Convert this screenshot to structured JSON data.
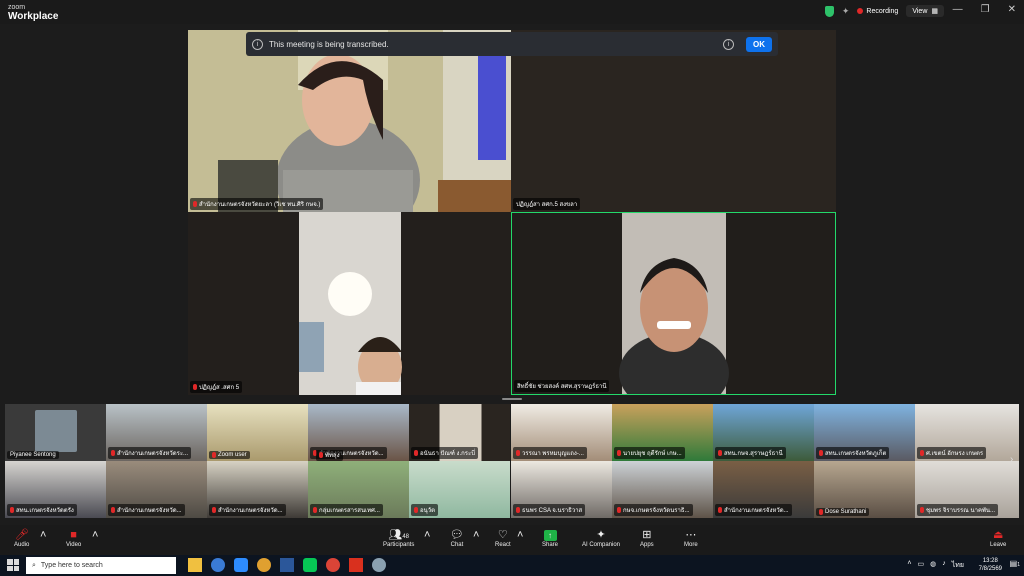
{
  "window": {
    "brand_small": "zoom",
    "brand": "Workplace",
    "recording": "Recording",
    "view": "View"
  },
  "banner": {
    "text": "This meeting is being transcribed.",
    "ok": "OK"
  },
  "main": [
    "สำนักงานเกษตรจังหวัดยะลา (วิเช ทน.ศิริ กษจ.)",
    "ปฏิญฎ์สา สศก.5 สงขลา",
    "ปฏิญฎ์ส .สศก 5",
    "สิทธิ์ชัย ช่วยสงค์ สศท.สุราษฎร์ธานี"
  ],
  "strip_top": [
    "Piyanee Sentong",
    "สำนักงานเกษตรจังหวัดระ...",
    "Zoom user",
    "สำนักงานเกษตรจังหวัด...",
    "พัทลุง",
    "อนันธา ปัณฑ์ ง.กระบี่",
    "วรรณา พรหมบุญแถง-...",
    "นายปยุช ฤดีรักษ์ เกษ...",
    "สทน.กษจ.สุราษฎร์ธานี",
    "สทน.เกษตรจังหวัดภูเก็ต",
    "ศ.เขตน์ อักษรง เกษตร"
  ],
  "strip_bottom": [
    "สทน.เกษตรจังหวัดตรัง",
    "สำนักงานเกษตรจังหวัด...",
    "สำนักงานเกษตรจังหวัด...",
    "กลุ่มเกษตรสารสนเทศ...",
    "อนุวัต",
    "ธนพร CSA จ.นราธิวาส",
    "กษจ.เกษตรจังหวัดนราธิ...",
    "สำนักงานเกษตรจังหวัด...",
    "Dose Surathani",
    "ชุมพร จิราบรรณ นาคพัน..."
  ],
  "toolbar": {
    "audio": "Audio",
    "video": "Video",
    "participants": "Participants",
    "participants_count": "48",
    "chat": "Chat",
    "react": "React",
    "share": "Share",
    "ai": "AI Companion",
    "apps": "Apps",
    "more": "More",
    "leave": "Leave"
  },
  "taskbar": {
    "search": "Type here to search",
    "lang": "ไทย",
    "time": "13:28",
    "date": "7/8/2569",
    "notif": "1"
  }
}
